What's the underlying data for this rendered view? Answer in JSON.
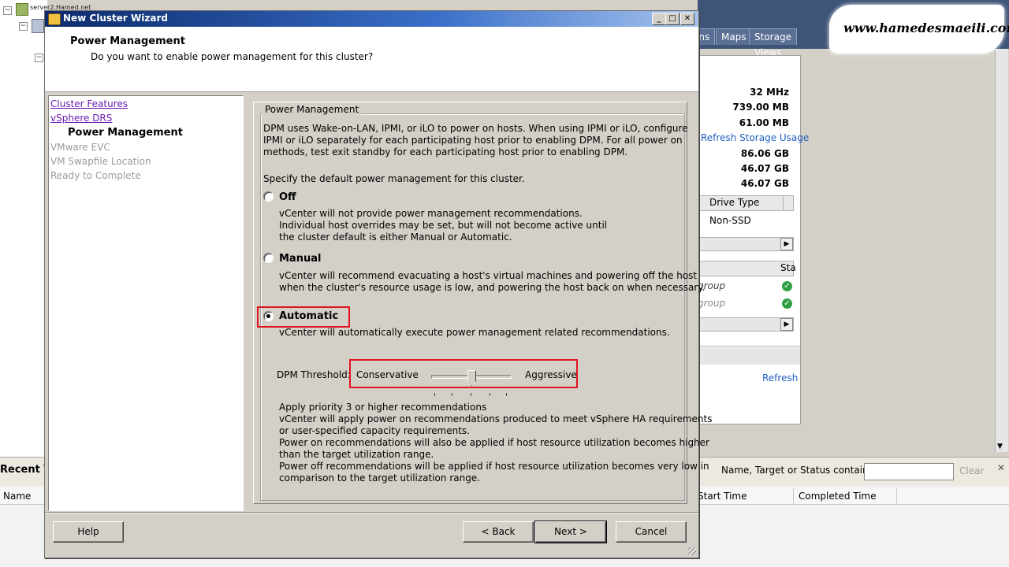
{
  "background": {
    "tree": {
      "server_label": "server2.Hamed.net"
    },
    "tabs": [
      "ons",
      "Maps",
      "Storage Views"
    ],
    "panel": {
      "values": [
        "32 MHz",
        "739.00 MB",
        "61.00 MB"
      ],
      "refresh_storage_link": "Refresh Storage Usage",
      "storage_values": [
        "86.06 GB",
        "46.07 GB",
        "46.07 GB"
      ],
      "drive_type_header": "Drive Type",
      "drive_type_value": "Non-SSD",
      "status_header": "Sta",
      "group_rows": [
        "group",
        "group"
      ],
      "refresh_link": "Refresh"
    },
    "recent_tasks": {
      "title": "Recent Ta",
      "filter_label": "Name, Target or Status contains: ▾",
      "clear_label": "Clear",
      "close_glyph": "✕",
      "columns": [
        "Name",
        "Start Time",
        "Completed Time"
      ]
    },
    "watermark": "www.hamedesmaeili.com"
  },
  "wizard": {
    "title": "New Cluster Wizard",
    "title_buttons": [
      "_",
      "□",
      "✕"
    ],
    "header": {
      "title": "Power Management",
      "subtitle": "Do you want to enable power management for this cluster?"
    },
    "nav": [
      {
        "label": "Cluster Features",
        "state": "visited"
      },
      {
        "label": "vSphere DRS",
        "state": "visited"
      },
      {
        "label": "Power Management",
        "state": "current"
      },
      {
        "label": "VMware EVC",
        "state": "disabled"
      },
      {
        "label": "VM Swapfile Location",
        "state": "disabled"
      },
      {
        "label": "Ready to Complete",
        "state": "disabled"
      }
    ],
    "group_title": "Power Management",
    "intro": [
      "DPM uses Wake-on-LAN, IPMI, or iLO to power on hosts. When using IPMI or iLO, configure",
      "IPMI or iLO separately for each participating host prior to enabling DPM. For all power on",
      "methods, test exit standby for each participating host prior to enabling DPM."
    ],
    "specify_label": "Specify the default power management for this cluster.",
    "options": {
      "off": {
        "label": "Off",
        "desc": [
          "vCenter will not provide power management recommendations.",
          "Individual host overrides may be set, but will not become active until",
          "the cluster default is either Manual or Automatic."
        ]
      },
      "manual": {
        "label": "Manual",
        "desc": [
          "vCenter will recommend evacuating a host's virtual machines and powering off the host",
          "when the cluster's resource usage is low, and powering the host back on when necessary."
        ]
      },
      "automatic": {
        "label": "Automatic",
        "desc": [
          "vCenter will automatically execute power management related recommendations."
        ]
      }
    },
    "selected_option": "automatic",
    "threshold": {
      "label": "DPM Threshold:",
      "min_label": "Conservative",
      "max_label": "Aggressive",
      "position": 3,
      "steps": 5
    },
    "threshold_desc": [
      "Apply priority 3 or higher recommendations",
      "vCenter will apply power on recommendations produced to meet vSphere HA requirements",
      "or user-specified capacity requirements.",
      "Power on recommendations will also be applied if host resource utilization becomes higher",
      "than the target utilization range.",
      "Power off recommendations will be applied if host resource utilization becomes very low in",
      "comparison to the target utilization range."
    ],
    "buttons": {
      "help": "Help",
      "back": "< Back",
      "next": "Next >",
      "cancel": "Cancel"
    }
  }
}
